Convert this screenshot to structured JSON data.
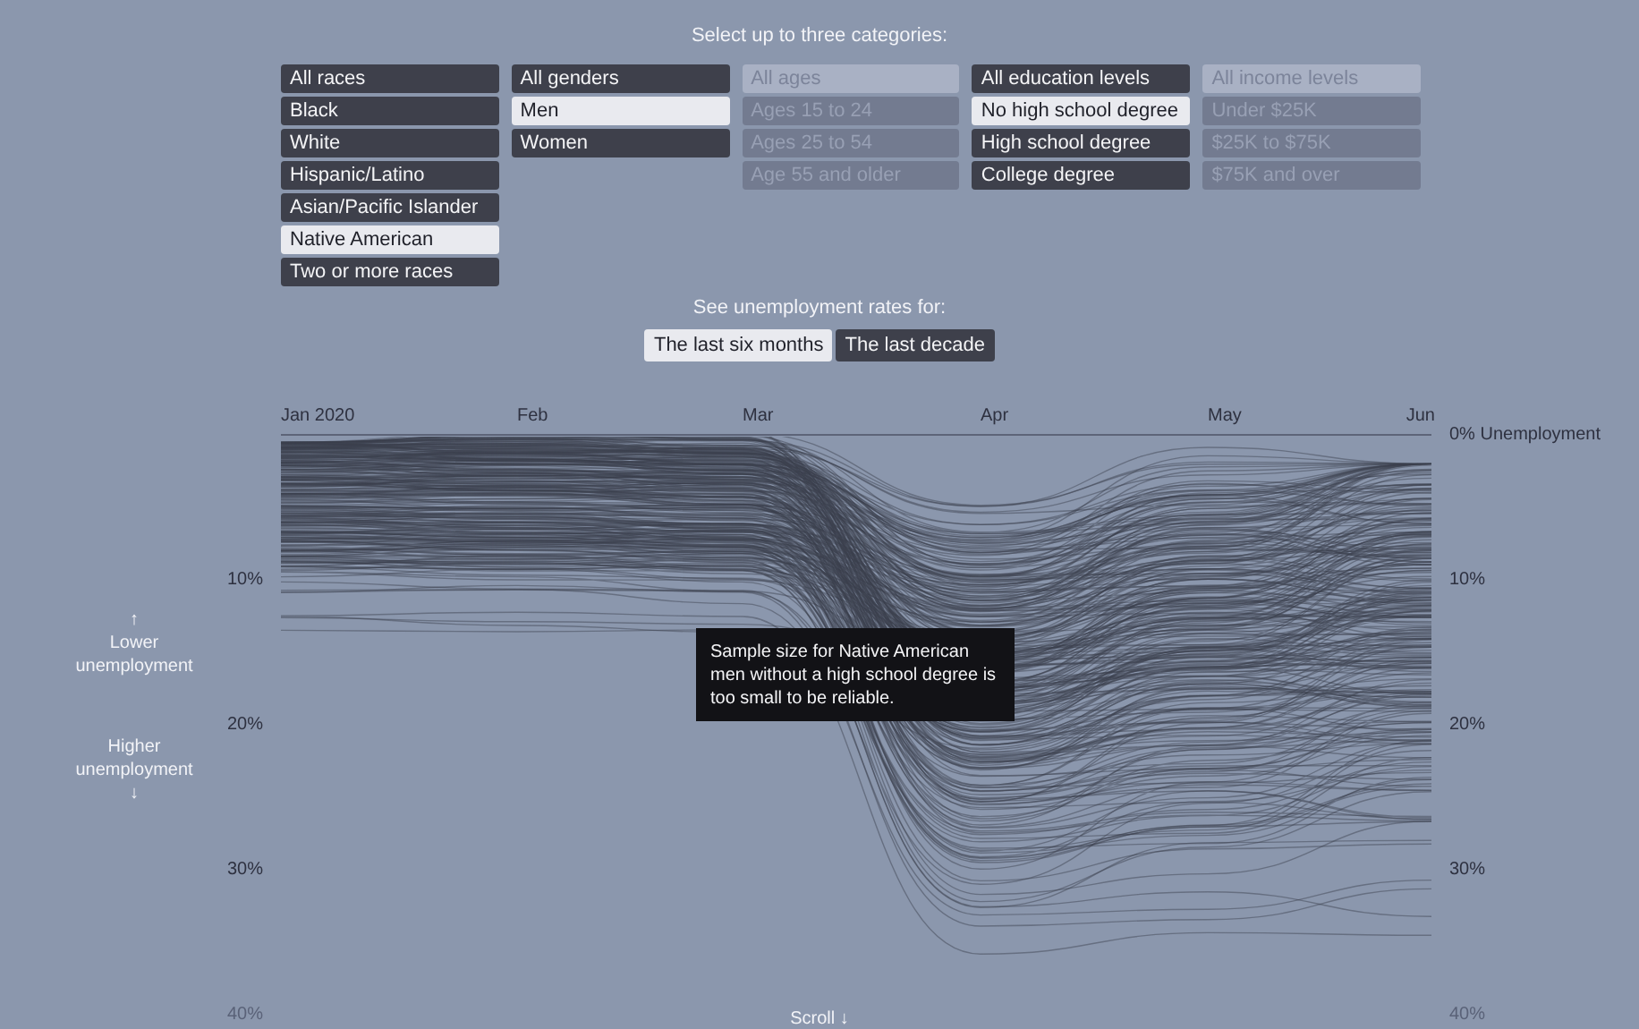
{
  "header": "Select up to three categories:",
  "filters": [
    {
      "options": [
        {
          "label": "All races",
          "selected": false,
          "disabled": false
        },
        {
          "label": "Black",
          "selected": false,
          "disabled": false
        },
        {
          "label": "White",
          "selected": false,
          "disabled": false
        },
        {
          "label": "Hispanic/Latino",
          "selected": false,
          "disabled": false
        },
        {
          "label": "Asian/Pacific Islander",
          "selected": false,
          "disabled": false
        },
        {
          "label": "Native American",
          "selected": true,
          "disabled": false
        },
        {
          "label": "Two or more races",
          "selected": false,
          "disabled": false
        }
      ]
    },
    {
      "options": [
        {
          "label": "All genders",
          "selected": false,
          "disabled": false
        },
        {
          "label": "Men",
          "selected": true,
          "disabled": false
        },
        {
          "label": "Women",
          "selected": false,
          "disabled": false
        }
      ]
    },
    {
      "options": [
        {
          "label": "All ages",
          "selected": true,
          "disabled": true
        },
        {
          "label": "Ages 15 to 24",
          "selected": false,
          "disabled": true
        },
        {
          "label": "Ages 25 to 54",
          "selected": false,
          "disabled": true
        },
        {
          "label": "Age 55 and older",
          "selected": false,
          "disabled": true
        }
      ]
    },
    {
      "options": [
        {
          "label": "All education levels",
          "selected": false,
          "disabled": false
        },
        {
          "label": "No high school degree",
          "selected": true,
          "disabled": false
        },
        {
          "label": "High school degree",
          "selected": false,
          "disabled": false
        },
        {
          "label": "College degree",
          "selected": false,
          "disabled": false
        }
      ]
    },
    {
      "options": [
        {
          "label": "All income levels",
          "selected": true,
          "disabled": true
        },
        {
          "label": "Under $25K",
          "selected": false,
          "disabled": true
        },
        {
          "label": "$25K to $75K",
          "selected": false,
          "disabled": true
        },
        {
          "label": "$75K and over",
          "selected": false,
          "disabled": true
        }
      ]
    }
  ],
  "period": {
    "label": "See unemployment rates for:",
    "options": [
      {
        "label": "The last six months",
        "selected": true
      },
      {
        "label": "The last decade",
        "selected": false
      }
    ]
  },
  "chart": {
    "months": [
      "Jan 2020",
      "Feb",
      "Mar",
      "Apr",
      "May",
      "Jun"
    ],
    "left_ticks": [
      {
        "label": "10%",
        "faded": false
      },
      {
        "label": "20%",
        "faded": false
      },
      {
        "label": "30%",
        "faded": false
      },
      {
        "label": "40%",
        "faded": true
      }
    ],
    "right_ticks": [
      {
        "label": "0% Unemployment",
        "faded": false
      },
      {
        "label": "10%",
        "faded": false
      },
      {
        "label": "20%",
        "faded": false
      },
      {
        "label": "30%",
        "faded": false
      },
      {
        "label": "40%",
        "faded": true
      }
    ],
    "legend_up": {
      "arrow": "↑",
      "text": "Lower unemployment"
    },
    "legend_down": {
      "arrow": "↓",
      "text": "Higher unemployment"
    },
    "tooltip": "Sample size for Native American men without a high school degree is too small to be reliable."
  },
  "scroll": "Scroll ↓"
}
